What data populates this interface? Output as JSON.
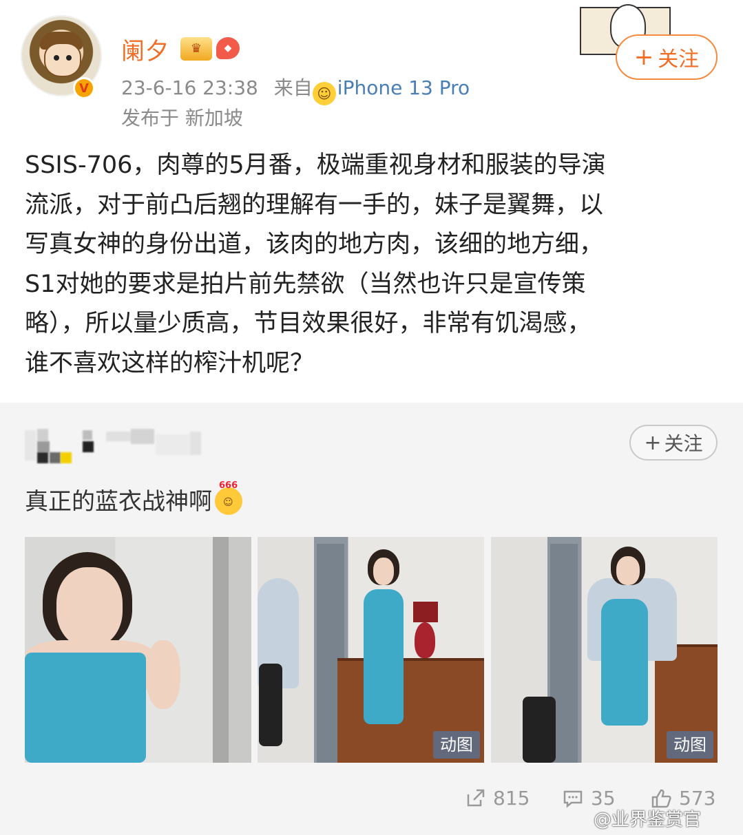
{
  "post": {
    "username": "阑夕",
    "timestamp": "23-6-16 23:38",
    "source_prefix": "来自",
    "device": "iPhone 13 Pro",
    "location": "发布于 新加坡",
    "follow_label": "关注",
    "text_lines": [
      "SSIS-706，肉尊的5月番，极端重视身材和服装的导演",
      "流派，对于前凸后翘的理解有一手的，妹子是翼舞，以",
      "写真女神的身份出道，该肉的地方肉，该细的地方细，",
      "S1对她的要求是拍片前先禁欲（当然也许只是宣传策",
      "略），所以量少质高，节目效果很好，非常有饥渴感，",
      "谁不喜欢这样的榨汁机呢？"
    ],
    "sticker_text": "微笑"
  },
  "repost": {
    "follow_label": "关注",
    "text": "真正的蓝衣战神啊",
    "emoji_label": "666",
    "gif_label": "动图",
    "actions": {
      "share_count": "815",
      "comment_count": "35",
      "like_count": "573"
    }
  },
  "watermark": "@业界鉴赏官",
  "colors": {
    "accent": "#f26d24",
    "link": "#4a7fb5",
    "meta": "#8a8a8a"
  }
}
